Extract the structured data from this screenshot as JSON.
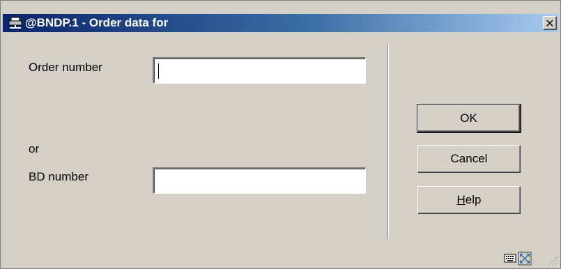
{
  "window": {
    "title": "@BNDP.1 - Order data for",
    "close_glyph": "✕"
  },
  "form": {
    "order_number_label": "Order number",
    "order_number_value": "",
    "or_label": "or",
    "bd_number_label": "BD number",
    "bd_number_value": ""
  },
  "buttons": {
    "ok": "OK",
    "cancel": "Cancel",
    "help_mnemonic": "H",
    "help_rest": "elp"
  },
  "icons": {
    "title": "network-printer-icon",
    "status": [
      "keyboard-icon",
      "expand-icon",
      "resize-grip-icon"
    ]
  },
  "colors": {
    "titlebar_start": "#0a246a",
    "titlebar_end": "#a6caf0",
    "face": "#d4d0c8"
  }
}
